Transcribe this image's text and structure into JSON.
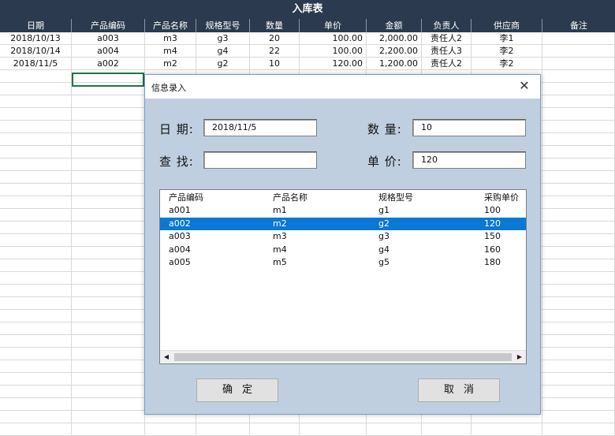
{
  "sheet": {
    "title": "入库表",
    "headers": [
      "日期",
      "产品编码",
      "产品名称",
      "规格型号",
      "数量",
      "单价",
      "金额",
      "负责人",
      "供应商",
      "备注"
    ],
    "rows": [
      [
        "2018/10/13",
        "a003",
        "m3",
        "g3",
        "20",
        "100.00",
        "2,000.00",
        "责任人2",
        "李1",
        ""
      ],
      [
        "2018/10/14",
        "a004",
        "m4",
        "g4",
        "22",
        "100.00",
        "2,200.00",
        "责任人3",
        "李2",
        ""
      ],
      [
        "2018/11/5",
        "a002",
        "m2",
        "g2",
        "10",
        "120.00",
        "1,200.00",
        "责任人2",
        "李2",
        ""
      ]
    ]
  },
  "dialog": {
    "title": "信息录入",
    "close_icon": "close-icon",
    "date_label": "日 期:",
    "date_value": "2018/11/5",
    "find_label": "查 找:",
    "find_value": "",
    "qty_label": "数 量:",
    "qty_value": "10",
    "price_label": "单 价:",
    "price_value": "120",
    "list": {
      "headers": [
        "产品编码",
        "产品名称",
        "规格型号",
        "采购单价"
      ],
      "rows": [
        [
          "a001",
          "m1",
          "g1",
          "100"
        ],
        [
          "a002",
          "m2",
          "g2",
          "120"
        ],
        [
          "a003",
          "m3",
          "g3",
          "150"
        ],
        [
          "a004",
          "m4",
          "g4",
          "160"
        ],
        [
          "a005",
          "m5",
          "g5",
          "180"
        ]
      ],
      "selected_index": 1
    },
    "ok_label": "确定",
    "cancel_label": "取消",
    "colors": {
      "selection": "#0a78d4",
      "dialog_bg": "#bfcfdf",
      "header_bg": "#2b3a4e"
    }
  }
}
